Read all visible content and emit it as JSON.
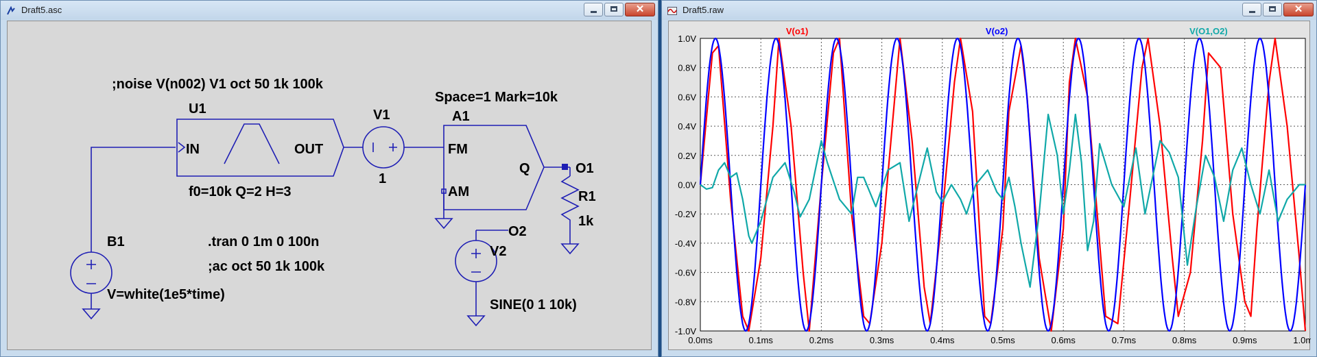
{
  "windows": {
    "schematic": {
      "title": "Draft5.asc"
    },
    "waveform": {
      "title": "Draft5.raw"
    }
  },
  "schematic": {
    "noise_directive": ";noise V(n002) V1 oct 50 1k 100k",
    "u1": {
      "name": "U1",
      "in_label": "IN",
      "out_label": "OUT",
      "params": "f0=10k Q=2 H=3"
    },
    "v1": {
      "name": "V1",
      "value": "1"
    },
    "a1": {
      "name": "A1",
      "params": "Space=1 Mark=10k",
      "fm_label": "FM",
      "am_label": "AM",
      "q_label": "Q"
    },
    "o1_label": "O1",
    "r1": {
      "name": "R1",
      "value": "1k"
    },
    "b1": {
      "name": "B1",
      "value": "V=white(1e5*time)"
    },
    "tran_directive": ".tran 0 1m 0 100n",
    "ac_directive": ";ac oct 50 1k 100k",
    "o2_label": "O2",
    "v2": {
      "name": "V2",
      "value": "SINE(0 1 10k)"
    }
  },
  "chart_data": {
    "type": "line",
    "x_ticks": [
      "0.0ms",
      "0.1ms",
      "0.2ms",
      "0.3ms",
      "0.4ms",
      "0.5ms",
      "0.6ms",
      "0.7ms",
      "0.8ms",
      "0.9ms",
      "1.0ms"
    ],
    "y_ticks": [
      "1.0V",
      "0.8V",
      "0.6V",
      "0.4V",
      "0.2V",
      "0.0V",
      "-0.2V",
      "-0.4V",
      "-0.6V",
      "-0.8V",
      "-1.0V"
    ],
    "xlim": [
      0,
      1.0
    ],
    "ylim": [
      -1.0,
      1.0
    ],
    "grid": true,
    "series": [
      {
        "name": "V(o1)",
        "color": "#ff0000",
        "points": [
          [
            0.0,
            0.0
          ],
          [
            0.02,
            0.9
          ],
          [
            0.03,
            0.95
          ],
          [
            0.05,
            -0.1
          ],
          [
            0.07,
            -0.9
          ],
          [
            0.08,
            -1.0
          ],
          [
            0.1,
            -0.5
          ],
          [
            0.12,
            0.4
          ],
          [
            0.13,
            1.0
          ],
          [
            0.15,
            0.4
          ],
          [
            0.17,
            -0.6
          ],
          [
            0.18,
            -1.0
          ],
          [
            0.2,
            0.0
          ],
          [
            0.22,
            0.9
          ],
          [
            0.23,
            1.0
          ],
          [
            0.25,
            -0.2
          ],
          [
            0.27,
            -0.9
          ],
          [
            0.28,
            -0.95
          ],
          [
            0.3,
            -0.4
          ],
          [
            0.33,
            1.0
          ],
          [
            0.35,
            0.3
          ],
          [
            0.37,
            -0.7
          ],
          [
            0.38,
            -0.95
          ],
          [
            0.4,
            -0.2
          ],
          [
            0.42,
            0.7
          ],
          [
            0.43,
            1.0
          ],
          [
            0.45,
            0.5
          ],
          [
            0.47,
            -0.9
          ],
          [
            0.48,
            -0.95
          ],
          [
            0.5,
            -0.3
          ],
          [
            0.51,
            0.5
          ],
          [
            0.53,
            0.95
          ],
          [
            0.54,
            0.6
          ],
          [
            0.56,
            -0.5
          ],
          [
            0.58,
            -1.0
          ],
          [
            0.6,
            -0.3
          ],
          [
            0.61,
            0.7
          ],
          [
            0.62,
            1.0
          ],
          [
            0.64,
            0.6
          ],
          [
            0.66,
            -0.4
          ],
          [
            0.67,
            -0.9
          ],
          [
            0.69,
            -0.95
          ],
          [
            0.71,
            -0.1
          ],
          [
            0.73,
            0.8
          ],
          [
            0.74,
            1.0
          ],
          [
            0.76,
            0.4
          ],
          [
            0.78,
            -0.5
          ],
          [
            0.79,
            -0.9
          ],
          [
            0.81,
            -0.6
          ],
          [
            0.83,
            0.3
          ],
          [
            0.84,
            0.9
          ],
          [
            0.86,
            0.8
          ],
          [
            0.88,
            -0.2
          ],
          [
            0.9,
            -0.8
          ],
          [
            0.91,
            -0.9
          ],
          [
            0.92,
            -0.3
          ],
          [
            0.94,
            0.7
          ],
          [
            0.95,
            1.0
          ],
          [
            0.97,
            0.4
          ],
          [
            0.99,
            -0.5
          ],
          [
            1.0,
            -1.0
          ]
        ]
      },
      {
        "name": "V(o2)",
        "color": "#0000ff",
        "function": "sin",
        "amplitude": 1.0,
        "frequency_per_ms": 10
      },
      {
        "name": "V(O1,O2)",
        "color": "#10a8a8",
        "points": [
          [
            0.0,
            0.0
          ],
          [
            0.01,
            -0.03
          ],
          [
            0.02,
            -0.02
          ],
          [
            0.03,
            0.1
          ],
          [
            0.04,
            0.15
          ],
          [
            0.05,
            0.05
          ],
          [
            0.06,
            0.08
          ],
          [
            0.07,
            -0.1
          ],
          [
            0.08,
            -0.35
          ],
          [
            0.085,
            -0.4
          ],
          [
            0.1,
            -0.25
          ],
          [
            0.12,
            0.05
          ],
          [
            0.14,
            0.15
          ],
          [
            0.155,
            -0.05
          ],
          [
            0.165,
            -0.22
          ],
          [
            0.18,
            -0.1
          ],
          [
            0.2,
            0.3
          ],
          [
            0.21,
            0.15
          ],
          [
            0.23,
            -0.1
          ],
          [
            0.25,
            -0.2
          ],
          [
            0.26,
            0.05
          ],
          [
            0.27,
            0.05
          ],
          [
            0.29,
            -0.15
          ],
          [
            0.31,
            0.1
          ],
          [
            0.33,
            0.15
          ],
          [
            0.345,
            -0.25
          ],
          [
            0.36,
            0.0
          ],
          [
            0.375,
            0.25
          ],
          [
            0.39,
            -0.05
          ],
          [
            0.4,
            -0.12
          ],
          [
            0.415,
            0.0
          ],
          [
            0.43,
            -0.1
          ],
          [
            0.44,
            -0.2
          ],
          [
            0.455,
            0.0
          ],
          [
            0.475,
            0.1
          ],
          [
            0.49,
            -0.05
          ],
          [
            0.5,
            -0.1
          ],
          [
            0.51,
            0.05
          ],
          [
            0.52,
            -0.15
          ],
          [
            0.53,
            -0.4
          ],
          [
            0.54,
            -0.6
          ],
          [
            0.545,
            -0.7
          ],
          [
            0.56,
            -0.2
          ],
          [
            0.575,
            0.48
          ],
          [
            0.59,
            0.2
          ],
          [
            0.6,
            -0.2
          ],
          [
            0.61,
            0.1
          ],
          [
            0.62,
            0.48
          ],
          [
            0.63,
            0.15
          ],
          [
            0.64,
            -0.45
          ],
          [
            0.65,
            -0.25
          ],
          [
            0.66,
            0.28
          ],
          [
            0.68,
            0.0
          ],
          [
            0.7,
            -0.15
          ],
          [
            0.72,
            0.25
          ],
          [
            0.735,
            -0.2
          ],
          [
            0.75,
            0.1
          ],
          [
            0.76,
            0.3
          ],
          [
            0.775,
            0.22
          ],
          [
            0.79,
            0.05
          ],
          [
            0.805,
            -0.55
          ],
          [
            0.82,
            -0.15
          ],
          [
            0.835,
            0.2
          ],
          [
            0.85,
            0.05
          ],
          [
            0.865,
            -0.25
          ],
          [
            0.88,
            0.1
          ],
          [
            0.895,
            0.25
          ],
          [
            0.91,
            0.0
          ],
          [
            0.925,
            -0.2
          ],
          [
            0.94,
            0.1
          ],
          [
            0.955,
            -0.25
          ],
          [
            0.97,
            -0.1
          ],
          [
            0.98,
            -0.05
          ],
          [
            0.99,
            0.0
          ],
          [
            1.0,
            0.0
          ]
        ]
      }
    ]
  }
}
